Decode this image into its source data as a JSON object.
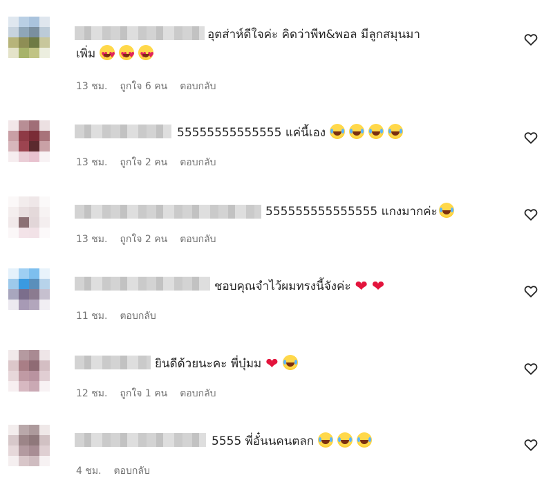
{
  "comments": [
    {
      "text": "อุตส่าห์ดีใจค่ะ คิดว่าพีท&พอล มีลูกสมุนมา",
      "text_line2": "เพิ่ม",
      "emojis": [
        "heart-eyes-emoji",
        "heart-eyes-emoji",
        "heart-eyes-emoji"
      ],
      "time": "13 ชม.",
      "likes": "ถูกใจ 6 คน",
      "reply": "ตอบกลับ"
    },
    {
      "text": "55555555555555 แค่นี้เอง",
      "emojis": [
        "laughing-emoji",
        "laughing-emoji",
        "laughing-emoji",
        "laughing-emoji"
      ],
      "time": "13 ชม.",
      "likes": "ถูกใจ 2 คน",
      "reply": "ตอบกลับ"
    },
    {
      "text": "555555555555555 แกงมากค่ะ",
      "emojis": [
        "laughing-emoji"
      ],
      "time": "13 ชม.",
      "likes": "ถูกใจ 2 คน",
      "reply": "ตอบกลับ"
    },
    {
      "text": "ชอบคุณจำไว้ผมทรงนี้จังค่ะ",
      "emojis": [
        "red-heart-emoji",
        "red-heart-emoji"
      ],
      "time": "11 ชม.",
      "reply": "ตอบกลับ"
    },
    {
      "text": "ยินดีด้วยนะคะ พี่บุ๋มม",
      "emojis": [
        "red-heart-emoji",
        "laughing-emoji"
      ],
      "time": "12 ชม.",
      "likes": "ถูกใจ 1 คน",
      "reply": "ตอบกลับ"
    },
    {
      "text": "5555 พี่อั๋นนคนตลก",
      "emojis": [
        "laughing-emoji",
        "laughing-emoji",
        "laughing-emoji"
      ],
      "time": "4 ชม.",
      "reply": "ตอบกลับ"
    }
  ],
  "icons": {
    "like": "heart-outline-icon"
  },
  "colors": {
    "text": "#262626",
    "meta": "#737373",
    "heart": "#e3143c"
  }
}
